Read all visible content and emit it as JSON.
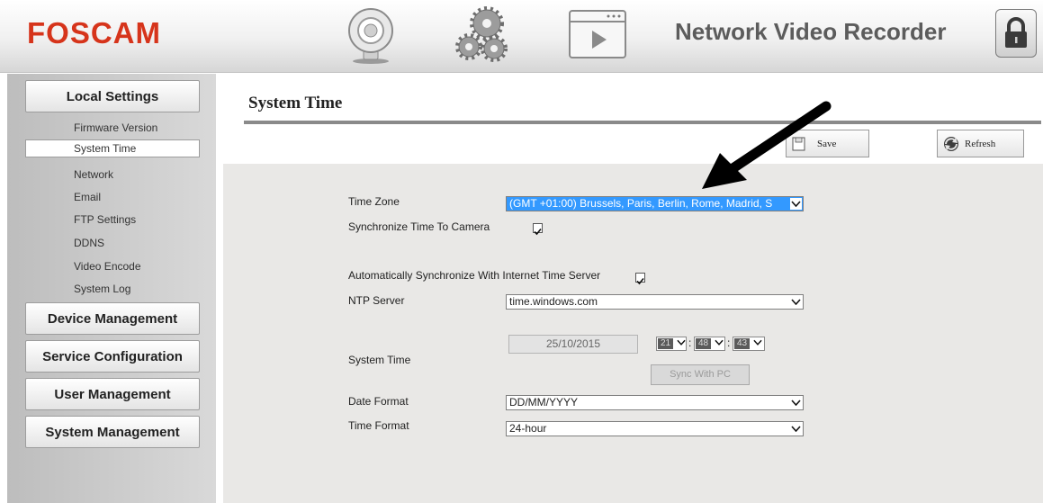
{
  "header": {
    "logo_text": "FOSCAM",
    "title": "Network Video Recorder",
    "icons": [
      "camera-icon",
      "gears-icon",
      "playback-icon",
      "lock-icon"
    ]
  },
  "sidebar": {
    "local_settings": {
      "label": "Local Settings",
      "items": [
        {
          "label": "Firmware Version"
        },
        {
          "label": "System Time",
          "selected": true
        },
        {
          "label": "Network"
        },
        {
          "label": "Email"
        },
        {
          "label": "FTP Settings"
        },
        {
          "label": "DDNS"
        },
        {
          "label": "Video Encode"
        },
        {
          "label": "System Log"
        }
      ]
    },
    "sections": [
      {
        "label": "Device Management"
      },
      {
        "label": "Service Configuration"
      },
      {
        "label": "User Management"
      },
      {
        "label": "System Management"
      }
    ]
  },
  "page": {
    "title": "System Time",
    "save_label": "Save",
    "refresh_label": "Refresh"
  },
  "form": {
    "time_zone": {
      "label": "Time Zone",
      "value": "(GMT +01:00) Brussels, Paris, Berlin, Rome, Madrid, S"
    },
    "sync_camera": {
      "label": "Synchronize Time To Camera",
      "checked": true
    },
    "auto_sync": {
      "label": "Automatically Synchronize With Internet Time Server",
      "checked": true
    },
    "ntp_server": {
      "label": "NTP Server",
      "value": "time.windows.com"
    },
    "system_time": {
      "label": "System Time",
      "date": "25/10/2015",
      "hour": "21",
      "minute": "48",
      "second": "43",
      "sync_button": "Sync With PC"
    },
    "date_format": {
      "label": "Date Format",
      "value": "DD/MM/YYYY"
    },
    "time_format": {
      "label": "Time Format",
      "value": "24-hour"
    }
  },
  "colors": {
    "logo": "#d6341b",
    "timezone_highlight": "#3399ff",
    "annotation_arrow": "#000000"
  }
}
